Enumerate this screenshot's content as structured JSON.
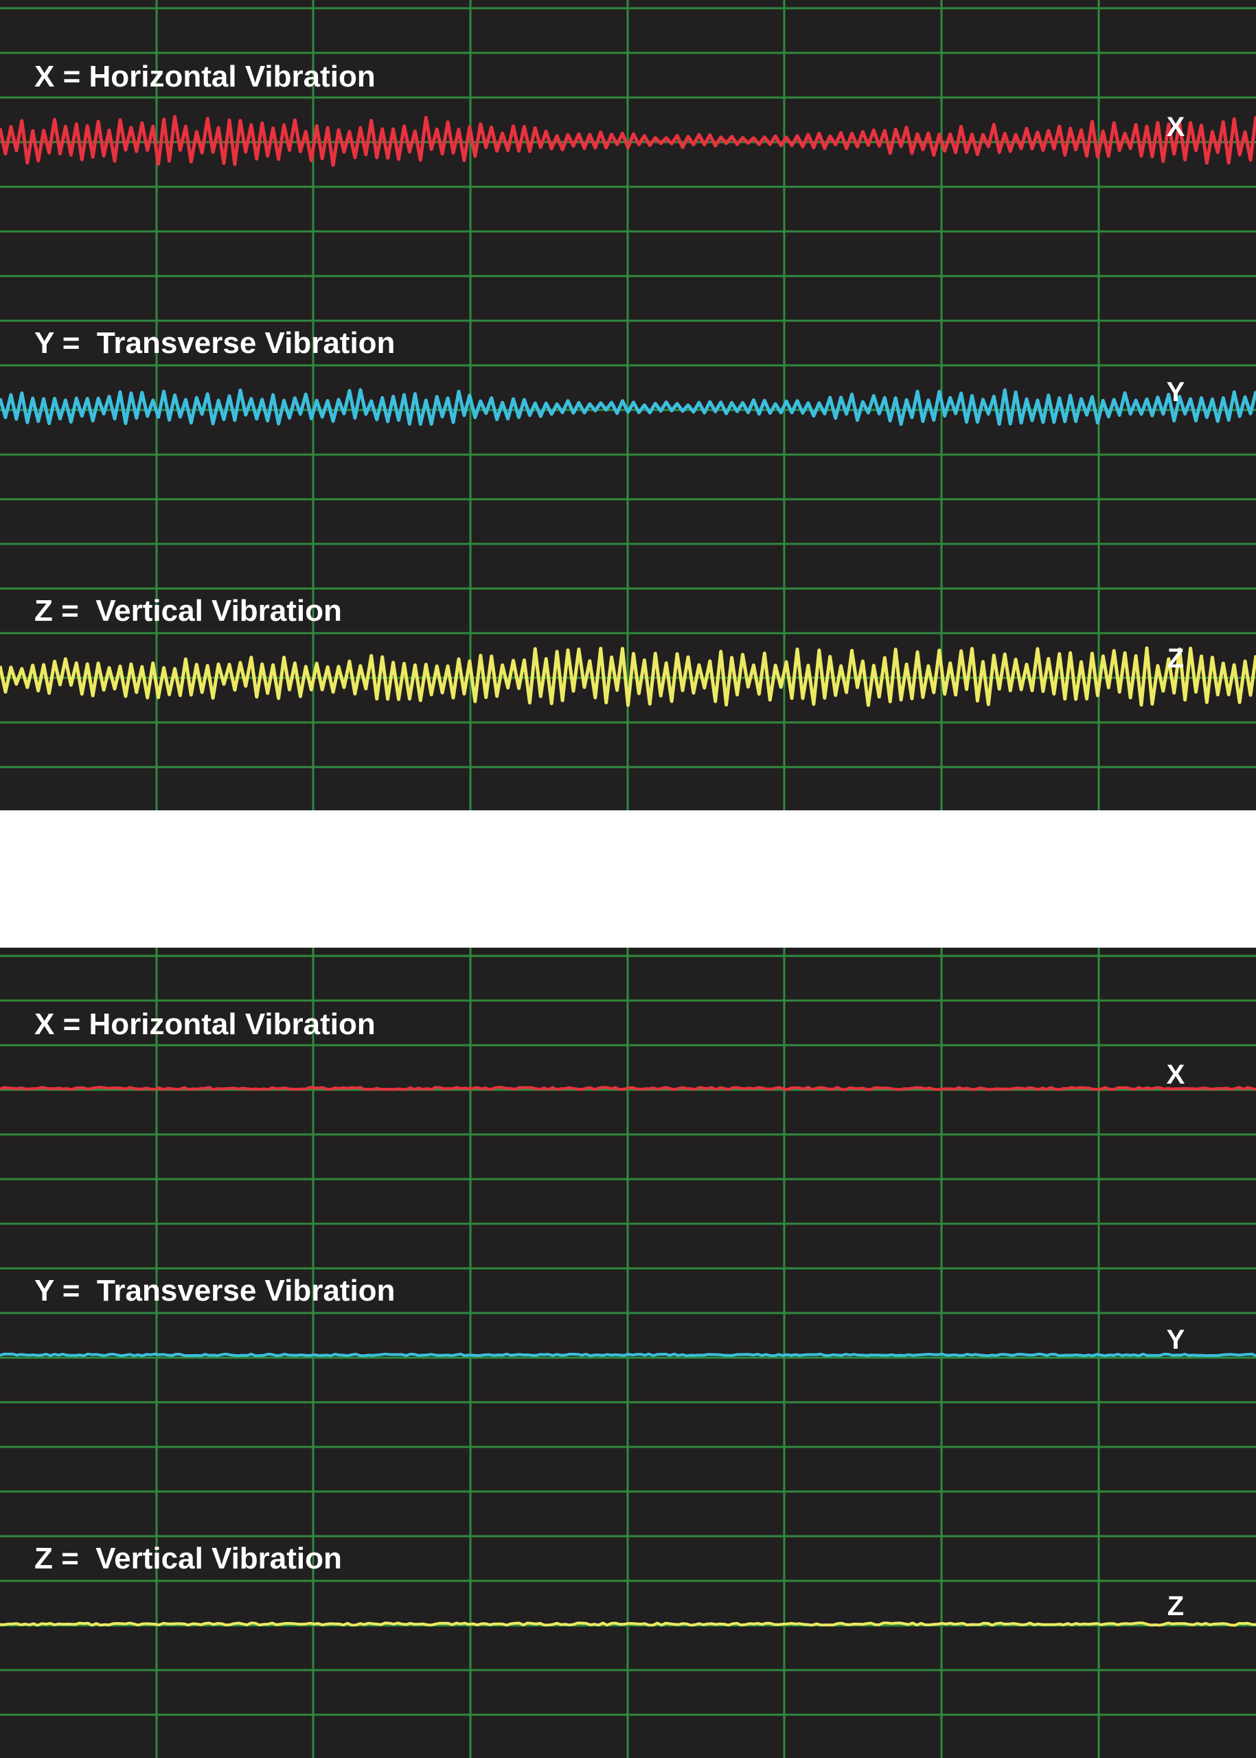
{
  "colors": {
    "background": "#221f20",
    "grid": "#2f8a3e",
    "x": "#e8333f",
    "y": "#3cbfde",
    "z": "#ecea62",
    "text": "#ffffff"
  },
  "chart_data": [
    {
      "type": "line",
      "title": "",
      "grid": true,
      "x_range": [
        0,
        1
      ],
      "y_range": [
        -1,
        1
      ],
      "series": [
        {
          "name": "X = Horizontal Vibration",
          "end_label": "X",
          "color": "#e8333f",
          "amplitude": 0.85,
          "envelope": [
            [
              0,
              1
            ],
            [
              0.33,
              1
            ],
            [
              0.46,
              0.4
            ],
            [
              0.6,
              0.2
            ],
            [
              0.72,
              0.55
            ],
            [
              1,
              1
            ]
          ],
          "seed": 11
        },
        {
          "name": "Y =  Transverse Vibration",
          "end_label": "Y",
          "color": "#3cbfde",
          "amplitude": 0.6,
          "envelope": [
            [
              0,
              1
            ],
            [
              0.35,
              1
            ],
            [
              0.45,
              0.45
            ],
            [
              0.55,
              0.3
            ],
            [
              0.62,
              0.5
            ],
            [
              0.72,
              1
            ],
            [
              1,
              1
            ]
          ],
          "seed": 23
        },
        {
          "name": "Z =  Vertical Vibration",
          "end_label": "Z",
          "color": "#ecea62",
          "amplitude": 1.0,
          "envelope": [
            [
              0,
              0.7
            ],
            [
              0.3,
              0.8
            ],
            [
              0.4,
              1
            ],
            [
              1,
              1
            ]
          ],
          "seed": 37
        }
      ]
    },
    {
      "type": "line",
      "title": "",
      "grid": true,
      "x_range": [
        0,
        1
      ],
      "y_range": [
        -1,
        1
      ],
      "series": [
        {
          "name": "X = Horizontal Vibration",
          "end_label": "X",
          "color": "#e8333f",
          "amplitude": 0.04,
          "envelope": [
            [
              0,
              1
            ],
            [
              1,
              1
            ]
          ],
          "seed": 51
        },
        {
          "name": "Y =  Transverse Vibration",
          "end_label": "Y",
          "color": "#3cbfde",
          "amplitude": 0.03,
          "envelope": [
            [
              0,
              1
            ],
            [
              1,
              1
            ]
          ],
          "seed": 63
        },
        {
          "name": "Z =  Vertical Vibration",
          "end_label": "Z",
          "color": "#ecea62",
          "amplitude": 0.04,
          "envelope": [
            [
              0,
              1
            ],
            [
              1,
              1
            ]
          ],
          "seed": 77
        }
      ]
    }
  ]
}
